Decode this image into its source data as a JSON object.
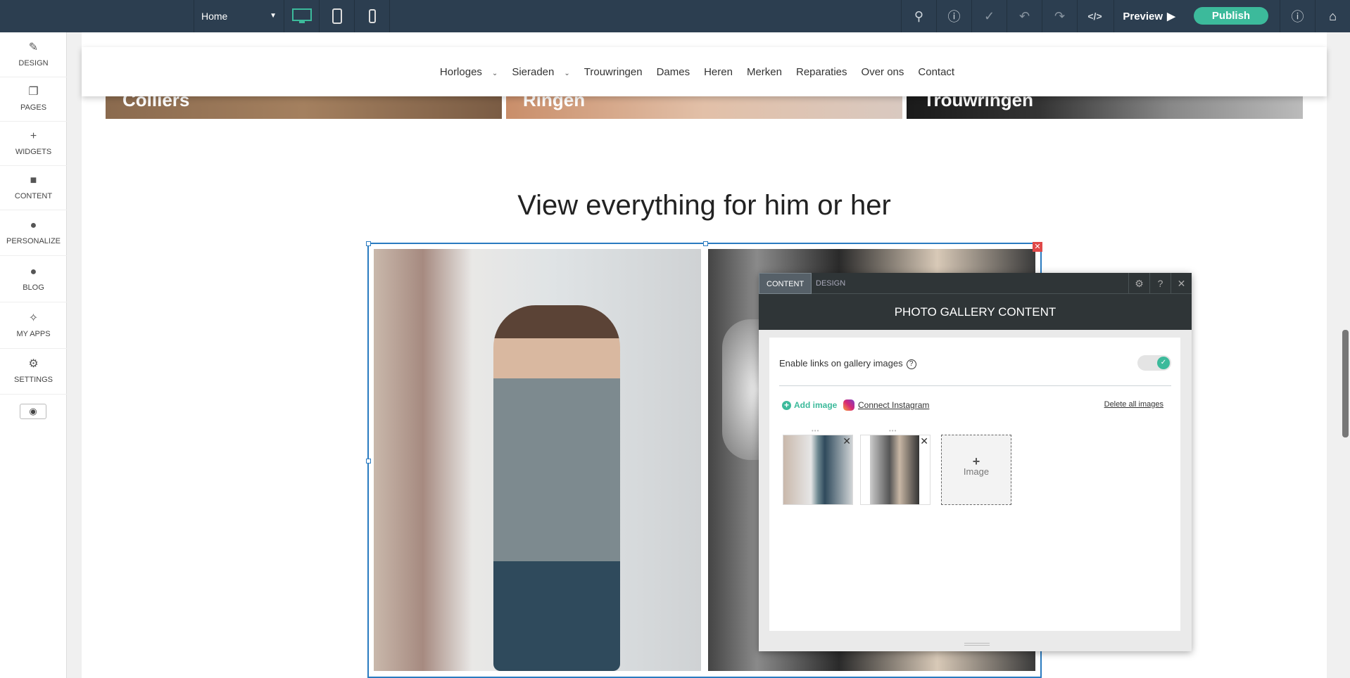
{
  "topbar": {
    "page_select": "Home",
    "devices": [
      "desktop-icon",
      "tablet-icon",
      "mobile-icon"
    ],
    "preview_label": "Preview",
    "publish_label": "Publish"
  },
  "sidebar": {
    "items": [
      {
        "label": "DESIGN",
        "icon": "brush-icon"
      },
      {
        "label": "PAGES",
        "icon": "pages-icon"
      },
      {
        "label": "WIDGETS",
        "icon": "plus-icon"
      },
      {
        "label": "CONTENT",
        "icon": "folder-icon"
      },
      {
        "label": "PERSONALIZE",
        "icon": "person-icon"
      },
      {
        "label": "BLOG",
        "icon": "chat-icon"
      },
      {
        "label": "MY APPS",
        "icon": "puzzle-icon"
      },
      {
        "label": "SETTINGS",
        "icon": "gear-icon"
      }
    ]
  },
  "site": {
    "nav": [
      "Horloges",
      "Sieraden",
      "Trouwringen",
      "Dames",
      "Heren",
      "Merken",
      "Reparaties",
      "Over ons",
      "Contact"
    ],
    "categories": [
      "Colliers",
      "Ringen",
      "Trouwringen"
    ],
    "heading": "View everything for him or her"
  },
  "panel": {
    "tabs": [
      "CONTENT",
      "DESIGN"
    ],
    "title": "PHOTO GALLERY CONTENT",
    "toggle_label": "Enable links on gallery images",
    "toggle_on": true,
    "add_image": "Add image",
    "connect_instagram": "Connect Instagram",
    "delete_all": "Delete all images",
    "add_tile_label": "Image"
  },
  "colors": {
    "accent": "#3cba9b",
    "topbar": "#2c3e50",
    "selection": "#2a7bc0"
  }
}
